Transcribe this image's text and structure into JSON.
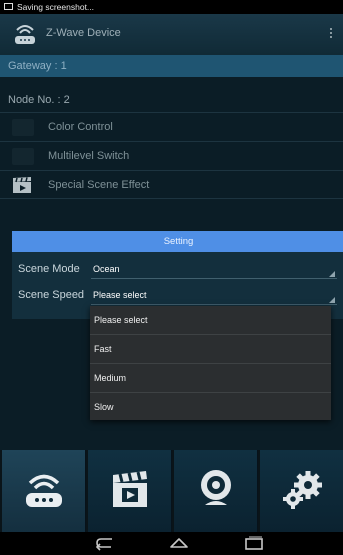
{
  "status_bar": {
    "notification_text": "Saving screenshot..."
  },
  "action_bar": {
    "title": "Z-Wave Device",
    "icon": "zwave-router-icon",
    "overflow_icon": "overflow-menu-icon"
  },
  "device": {
    "gateway_label": "Gateway : 1",
    "node_label": "Node No. : 2"
  },
  "device_functions": [
    {
      "label": "Color Control",
      "icon": "color-control-icon"
    },
    {
      "label": "Multilevel Switch",
      "icon": "multilevel-switch-icon"
    },
    {
      "label": "Special Scene Effect",
      "icon": "clapperboard-icon"
    }
  ],
  "setting_dialog": {
    "title": "Setting",
    "scene_mode": {
      "label": "Scene Mode",
      "value": "Ocean"
    },
    "scene_speed": {
      "label": "Scene Speed",
      "value": "Please select"
    }
  },
  "speed_options": [
    "Please select",
    "Fast",
    "Medium",
    "Slow"
  ],
  "tabs": [
    {
      "icon": "zwave-router-icon",
      "selected": true
    },
    {
      "icon": "clapperboard-icon",
      "selected": false
    },
    {
      "icon": "webcam-icon",
      "selected": false
    },
    {
      "icon": "gears-icon",
      "selected": false
    }
  ],
  "nav_bar": [
    "back-icon",
    "home-icon",
    "recents-icon"
  ],
  "colors": {
    "accent_blue": "#4f8fe6",
    "gateway_highlight": "#1f5572",
    "background": "#0b1d26"
  }
}
